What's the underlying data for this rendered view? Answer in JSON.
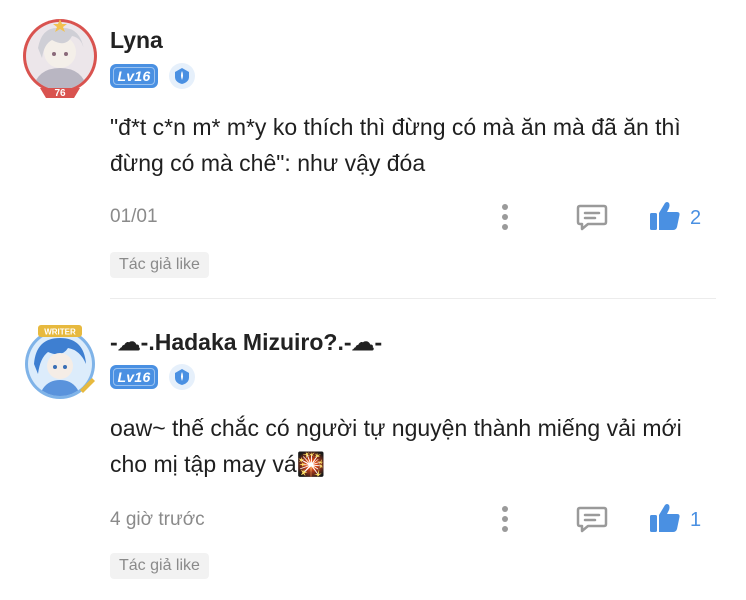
{
  "comments": [
    {
      "username": "Lyna",
      "level": "Lv16",
      "avatar_icon": "anime-girl-avatar-with-badge",
      "avatar_badge_number": "76",
      "text": "\"đ*t c*n m* m*y ko thích thì đừng có mà ăn mà đã ăn thì đừng có mà chê\": như vậy đóa",
      "timestamp": "01/01",
      "likes": "2",
      "author_like_label": "Tác giả like"
    },
    {
      "username": "-☁-.Hadaka Mizuiro?.-☁-",
      "level": "Lv16",
      "avatar_icon": "writer-badge-anime-avatar",
      "avatar_badge_text": "WRITER",
      "text": "oaw~ thế chắc có người tự nguyện thành miếng vải mới cho mị tập may vá🎇",
      "timestamp": "4 giờ trước",
      "likes": "1",
      "author_like_label": "Tác giả like"
    }
  ],
  "colors": {
    "accent": "#4a90e2",
    "muted_text": "#8a8a8a",
    "tag_bg": "#f2f2f2"
  }
}
